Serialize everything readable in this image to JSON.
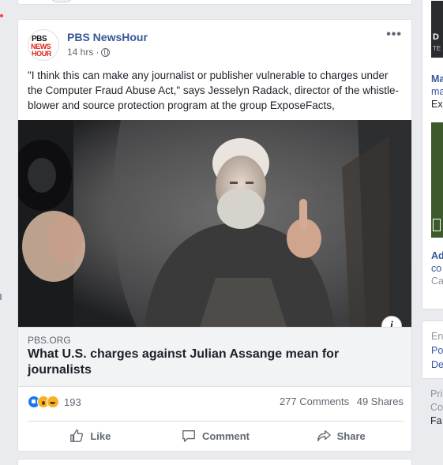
{
  "post": {
    "page_name": "PBS NewsHour",
    "avatar_lines": [
      "PBS",
      "NEWS",
      "HOUR"
    ],
    "time": "14 hrs",
    "separator": "·",
    "more_icon": "more-horizontal-icon",
    "text": "\"I think this can make any journalist or publisher vulnerable to charges under the Computer Fraud Abuse Act,\" says Jesselyn Radack, director of the whistle-blower and source protection program at the group ExposeFacts,",
    "link": {
      "domain": "PBS.ORG",
      "title": "What U.S. charges against Julian Assange mean for journalists",
      "info_label": "i"
    },
    "stats": {
      "reaction_count": "193",
      "comments": "277 Comments",
      "shares": "49 Shares"
    },
    "actions": {
      "like": "Like",
      "comment": "Comment",
      "share": "Share"
    }
  },
  "right_column": {
    "card1": {
      "d": "D",
      "te": "TE",
      "ma": "Ma",
      "ma2": "ma",
      "ex": "Ex"
    },
    "card2": {
      "ad": "Ad",
      "co": "co",
      "ca": "Ca"
    },
    "card3": {
      "en": "En",
      "po": "Po",
      "de": "De"
    },
    "card4": {
      "pri": "Pri",
      "co": "Co",
      "fa": "Fa"
    }
  },
  "colors": {
    "page_background": "#e9ebee",
    "link_blue": "#385898",
    "like_blue": "#1877f2",
    "notification_red": "#fa3e3e"
  }
}
